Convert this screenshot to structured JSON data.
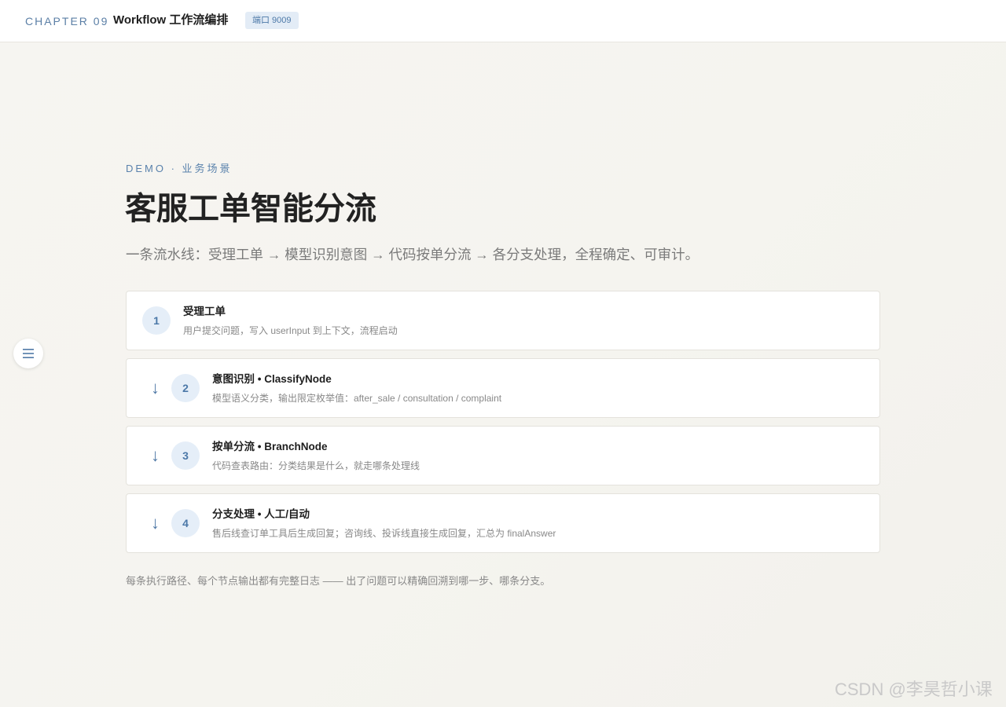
{
  "topbar": {
    "chapter": "CHAPTER 09",
    "title": "Workflow 工作流编排",
    "port_badge": "端口 9009"
  },
  "menu": {
    "icon": "menu-icon"
  },
  "hero": {
    "eyebrow": "DEMO · 业务场景",
    "title": "客服工单智能分流",
    "subtitle": "一条流水线：受理工单 → 模型识别意图 → 代码按单分流 → 各分支处理，全程确定、可审计。"
  },
  "steps": [
    {
      "number": "1",
      "arrow": "",
      "title": "受理工单",
      "desc": "用户提交问题，写入 userInput 到上下文，流程启动"
    },
    {
      "number": "2",
      "arrow": "↓",
      "title": "意图识别 • ClassifyNode",
      "desc": "模型语义分类，输出限定枚举值：after_sale / consultation / complaint"
    },
    {
      "number": "3",
      "arrow": "↓",
      "title": "按单分流 • BranchNode",
      "desc": "代码查表路由：分类结果是什么，就走哪条处理线"
    },
    {
      "number": "4",
      "arrow": "↓",
      "title": "分支处理 • 人工/自动",
      "desc": "售后线查订单工具后生成回复；咨询线、投诉线直接生成回复，汇总为 finalAnswer"
    }
  ],
  "footnote": "每条执行路径、每个节点输出都有完整日志 —— 出了问题可以精确回溯到哪一步、哪条分支。",
  "watermark": "CSDN @李昊哲小课",
  "colors": {
    "accent": "#4b78a8",
    "badge_bg": "#e3ecf6",
    "page_bg": "#f5f4ef"
  }
}
